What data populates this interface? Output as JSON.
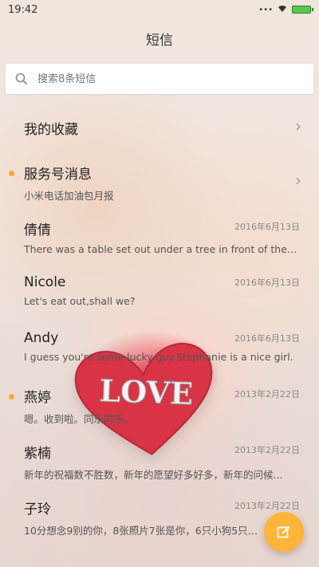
{
  "status_bar": {
    "time": "19:42"
  },
  "header": {
    "title": "短信"
  },
  "search": {
    "placeholder": "搜索8条短信"
  },
  "favorites": {
    "label": "我的收藏"
  },
  "service": {
    "title": "服务号消息",
    "subtitle": "小米电话加油包月报"
  },
  "conversations": [
    {
      "name": "倩倩",
      "preview": "There was a table set out under a tree in front of the ho...",
      "date": "2016年6月13日"
    },
    {
      "name": "Nicole",
      "preview": "Let's eat out,shall we?",
      "date": "2016年6月13日"
    },
    {
      "name": "Andy",
      "preview": "I guess you're some lucky guy.Stephanie is a nice girl.",
      "date": "2016年6月13日"
    },
    {
      "name": "燕婷",
      "preview": "嗯。收到啦。同乐同乐。",
      "date": "2013年2月22日"
    },
    {
      "name": "紫楠",
      "preview": "新年的祝福数不胜数，新年的愿望好多好多，新年的问候...",
      "date": "2013年2月22日"
    },
    {
      "name": "子玲",
      "preview": "10分想念9别的你，8张照片7张是你，6只小狗5只像你...",
      "date": "2013年2月22日"
    }
  ],
  "art": {
    "heart_text": "LOVE"
  },
  "colors": {
    "accent": "#ffb43a",
    "unread_dot": "#ffa43a"
  },
  "icons": {
    "search": "search-icon",
    "compose": "compose-icon"
  }
}
